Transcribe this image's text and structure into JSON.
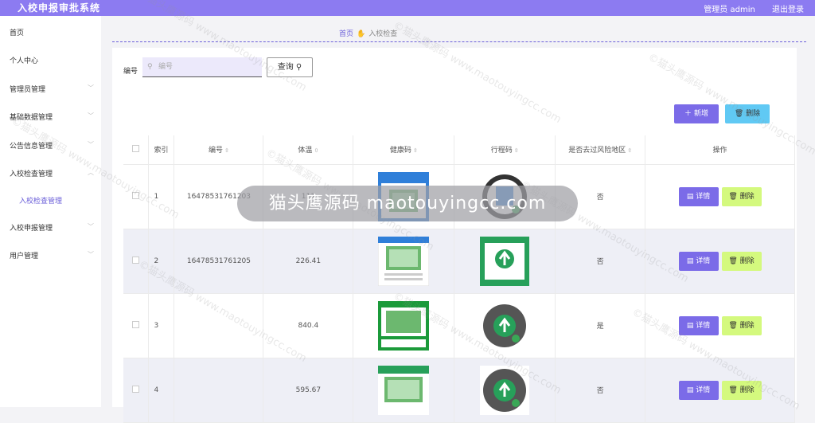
{
  "app": {
    "title": "入校申报审批系统",
    "user": "管理员 admin",
    "logout": "退出登录"
  },
  "sidebar": {
    "items": [
      {
        "label": "首页"
      },
      {
        "label": "个人中心"
      },
      {
        "label": "管理员管理"
      },
      {
        "label": "基础数据管理"
      },
      {
        "label": "公告信息管理"
      },
      {
        "label": "入校检查管理"
      },
      {
        "label": "入校检查管理"
      },
      {
        "label": "入校申报管理"
      },
      {
        "label": "用户管理"
      }
    ]
  },
  "breadcrumb": {
    "home": "首页",
    "current": "入校检查"
  },
  "search": {
    "label": "编号",
    "placeholder": "编号",
    "button": "查询"
  },
  "toolbar": {
    "add": "新增",
    "delete": "删除"
  },
  "table": {
    "headers": [
      "索引",
      "编号",
      "体温",
      "健康码",
      "行程码",
      "是否去过风险地区",
      "操作"
    ],
    "rows": [
      {
        "index": "1",
        "number": "16478531761203",
        "temp": "111",
        "risk": "否"
      },
      {
        "index": "2",
        "number": "16478531761205",
        "temp": "226.41",
        "risk": "否"
      },
      {
        "index": "3",
        "number": "",
        "temp": "840.4",
        "risk": "是"
      },
      {
        "index": "4",
        "number": "",
        "temp": "595.67",
        "risk": "否"
      }
    ],
    "detail_label": "详情",
    "delete_label": "删除"
  },
  "overlay": {
    "text": "猫头鹰源码 maotouyingcc.com"
  },
  "watermark": {
    "text": "©猫头鹰源码 www.maotouyingcc.com"
  },
  "colors": {
    "accent": "#7b6be8",
    "topbar": "#8c7bf1",
    "danger_btn": "#d4f97e",
    "delete_top": "#60c9f4"
  }
}
